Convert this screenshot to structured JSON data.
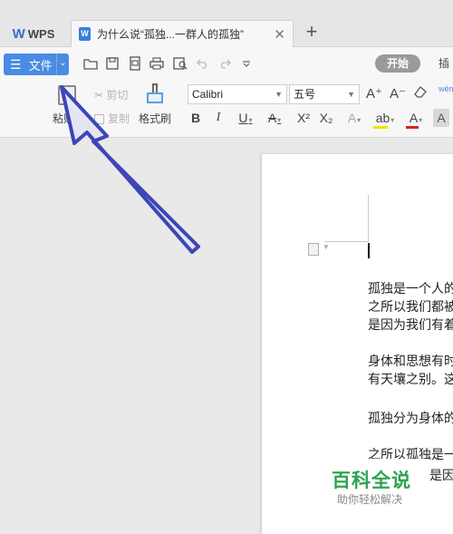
{
  "app": {
    "logo_glyph": "W",
    "name": "WPS"
  },
  "tab": {
    "icon_letter": "W",
    "title": "为什么说“孤独...一群人的孤独”",
    "close_glyph": "✕"
  },
  "new_tab_glyph": "+",
  "toolbar": {
    "file_menu": {
      "hamburger": "☰",
      "label": "文件",
      "dropdown_glyph": "⌄"
    },
    "ribbon_tabs": {
      "start": "开始",
      "insert": "插"
    }
  },
  "ribbon": {
    "paste": {
      "label": "粘贴",
      "dropdown_glyph": "▾"
    },
    "cut": {
      "label": "剪切",
      "glyph": "✂"
    },
    "copy": {
      "label": "复制"
    },
    "format_painter": {
      "label": "格式刷"
    },
    "font_name": "Calibri",
    "font_size": "五号",
    "increase_font": "A⁺",
    "decrease_font": "A⁻",
    "bold": "B",
    "italic": "I",
    "underline": "U",
    "strikethrough": "A",
    "superscript": "X²",
    "subscript": "X₂",
    "text_effect": "A",
    "highlight": "ab",
    "font_color": "A",
    "char_shading": "A",
    "phonetic": "wén"
  },
  "document": {
    "lines": [
      "孤独是一个人的",
      "之所以我们都被",
      "是因为我们有着",
      "身体和思想有时",
      "有天壤之别。这",
      "孤独分为身体的",
      "之所以孤独是一"
    ],
    "trailing_fragment": "是因"
  },
  "watermark": {
    "title": "百科全说",
    "subtitle": "助你轻松解决"
  },
  "colors": {
    "accent": "#4a8be3",
    "highlight": "#f3e200",
    "font_color": "#d9241b",
    "watermark_green": "#2ea34f",
    "arrow": "#3d46b8"
  }
}
